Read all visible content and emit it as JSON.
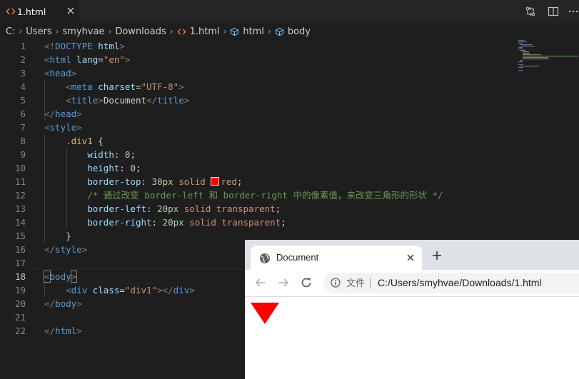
{
  "editor": {
    "tab": {
      "title": "1.html"
    },
    "breadcrumb": [
      "C:",
      "Users",
      "smyhvae",
      "Downloads",
      "1.html",
      "html",
      "body"
    ],
    "lines": [
      {
        "n": "1",
        "t": [
          [
            "t-br",
            "<!"
          ],
          [
            "t-tag",
            "DOCTYPE"
          ],
          [
            "t-txt",
            " "
          ],
          [
            "t-attr",
            "html"
          ],
          [
            "t-br",
            ">"
          ]
        ]
      },
      {
        "n": "2",
        "t": [
          [
            "t-br",
            "<"
          ],
          [
            "t-tag",
            "html"
          ],
          [
            "t-txt",
            " "
          ],
          [
            "t-attr",
            "lang"
          ],
          [
            "t-txt",
            "="
          ],
          [
            "t-str",
            "\"en\""
          ],
          [
            "t-br",
            ">"
          ]
        ]
      },
      {
        "n": "3",
        "t": [
          [
            "t-br",
            "<"
          ],
          [
            "t-tag",
            "head"
          ],
          [
            "t-br",
            ">"
          ]
        ]
      },
      {
        "n": "4",
        "t": [
          [
            "t-txt",
            "    "
          ],
          [
            "t-br",
            "<"
          ],
          [
            "t-tag",
            "meta"
          ],
          [
            "t-txt",
            " "
          ],
          [
            "t-attr",
            "charset"
          ],
          [
            "t-txt",
            "="
          ],
          [
            "t-str",
            "\"UTF-8\""
          ],
          [
            "t-br",
            ">"
          ]
        ]
      },
      {
        "n": "5",
        "t": [
          [
            "t-txt",
            "    "
          ],
          [
            "t-br",
            "<"
          ],
          [
            "t-tag",
            "title"
          ],
          [
            "t-br",
            ">"
          ],
          [
            "t-txt",
            "Document"
          ],
          [
            "t-br",
            "</"
          ],
          [
            "t-tag",
            "title"
          ],
          [
            "t-br",
            ">"
          ]
        ]
      },
      {
        "n": "6",
        "t": [
          [
            "t-br",
            "</"
          ],
          [
            "t-tag",
            "head"
          ],
          [
            "t-br",
            ">"
          ]
        ]
      },
      {
        "n": "7",
        "t": [
          [
            "t-br",
            "<"
          ],
          [
            "t-tag",
            "style"
          ],
          [
            "t-br",
            ">"
          ]
        ]
      },
      {
        "n": "8",
        "t": [
          [
            "t-txt",
            "    "
          ],
          [
            "t-sel",
            ".div1"
          ],
          [
            "t-punc",
            " {"
          ]
        ]
      },
      {
        "n": "9",
        "t": [
          [
            "t-txt",
            "        "
          ],
          [
            "t-prop",
            "width"
          ],
          [
            "t-punc",
            ": "
          ],
          [
            "t-num",
            "0"
          ],
          [
            "t-punc",
            ";"
          ]
        ]
      },
      {
        "n": "10",
        "t": [
          [
            "t-txt",
            "        "
          ],
          [
            "t-prop",
            "height"
          ],
          [
            "t-punc",
            ": "
          ],
          [
            "t-num",
            "0"
          ],
          [
            "t-punc",
            ";"
          ]
        ]
      },
      {
        "n": "11",
        "t": [
          [
            "t-txt",
            "        "
          ],
          [
            "t-prop",
            "border-top"
          ],
          [
            "t-punc",
            ": "
          ],
          [
            "t-num",
            "30px"
          ],
          [
            "t-txt",
            " "
          ],
          [
            "t-val",
            "solid"
          ],
          [
            "t-txt",
            " "
          ],
          [
            "swatch",
            ""
          ],
          [
            "t-val",
            "red"
          ],
          [
            "t-punc",
            ";"
          ]
        ]
      },
      {
        "n": "12",
        "t": [
          [
            "t-txt",
            "        "
          ],
          [
            "t-cmt",
            "/* 通过改变 border-left 和 border-right 中的像素值，来改变三角形的形状 */"
          ]
        ]
      },
      {
        "n": "13",
        "t": [
          [
            "t-txt",
            "        "
          ],
          [
            "t-prop",
            "border-left"
          ],
          [
            "t-punc",
            ": "
          ],
          [
            "t-num",
            "20px"
          ],
          [
            "t-txt",
            " "
          ],
          [
            "t-val",
            "solid"
          ],
          [
            "t-txt",
            " "
          ],
          [
            "t-val",
            "transparent"
          ],
          [
            "t-punc",
            ";"
          ]
        ]
      },
      {
        "n": "14",
        "t": [
          [
            "t-txt",
            "        "
          ],
          [
            "t-prop",
            "border-right"
          ],
          [
            "t-punc",
            ": "
          ],
          [
            "t-num",
            "20px"
          ],
          [
            "t-txt",
            " "
          ],
          [
            "t-val",
            "solid"
          ],
          [
            "t-txt",
            " "
          ],
          [
            "t-val",
            "transparent"
          ],
          [
            "t-punc",
            ";"
          ]
        ]
      },
      {
        "n": "15",
        "t": [
          [
            "t-txt",
            "    "
          ],
          [
            "t-punc",
            "}"
          ]
        ]
      },
      {
        "n": "16",
        "t": [
          [
            "t-br",
            "</"
          ],
          [
            "t-tag",
            "style"
          ],
          [
            "t-br",
            ">"
          ]
        ]
      },
      {
        "n": "17",
        "t": []
      },
      {
        "n": "18",
        "t": [
          [
            "t-br match",
            "<"
          ],
          [
            "t-tag",
            "body"
          ],
          [
            "t-br match",
            ">"
          ]
        ]
      },
      {
        "n": "19",
        "t": [
          [
            "t-txt",
            "    "
          ],
          [
            "t-br",
            "<"
          ],
          [
            "t-tag",
            "div"
          ],
          [
            "t-txt",
            " "
          ],
          [
            "t-attr",
            "class"
          ],
          [
            "t-txt",
            "="
          ],
          [
            "t-str",
            "\"div1\""
          ],
          [
            "t-br",
            "></"
          ],
          [
            "t-tag",
            "div"
          ],
          [
            "t-br",
            ">"
          ]
        ]
      },
      {
        "n": "20",
        "t": [
          [
            "t-br",
            "</"
          ],
          [
            "t-tag",
            "body"
          ],
          [
            "t-br",
            ">"
          ]
        ]
      },
      {
        "n": "21",
        "t": []
      },
      {
        "n": "22",
        "t": [
          [
            "t-br",
            "</"
          ],
          [
            "t-tag",
            "html"
          ],
          [
            "t-br",
            ">"
          ]
        ]
      }
    ],
    "current_line": "18"
  },
  "browser": {
    "tab_title": "Document",
    "security_label": "文件",
    "url": "C:/Users/smyhvae/Downloads/1.html",
    "rendered": {
      "shape": "triangle",
      "color": "#ff0000"
    }
  },
  "icons": [
    "html-file-icon",
    "close-icon",
    "compare-changes-icon",
    "split-editor-icon",
    "more-actions-icon",
    "chevron-right-icon",
    "element-icon",
    "globe-icon",
    "new-tab-icon",
    "back-icon",
    "forward-icon",
    "reload-icon",
    "info-icon"
  ],
  "colors": {
    "editor_bg": "#1e1e1e",
    "tag": "#569cd6",
    "attr": "#9cdcfe",
    "string": "#ce9178",
    "comment": "#6a9955",
    "number": "#b5cea8",
    "selector": "#d7ba7d",
    "triangle": "#ff0000"
  }
}
